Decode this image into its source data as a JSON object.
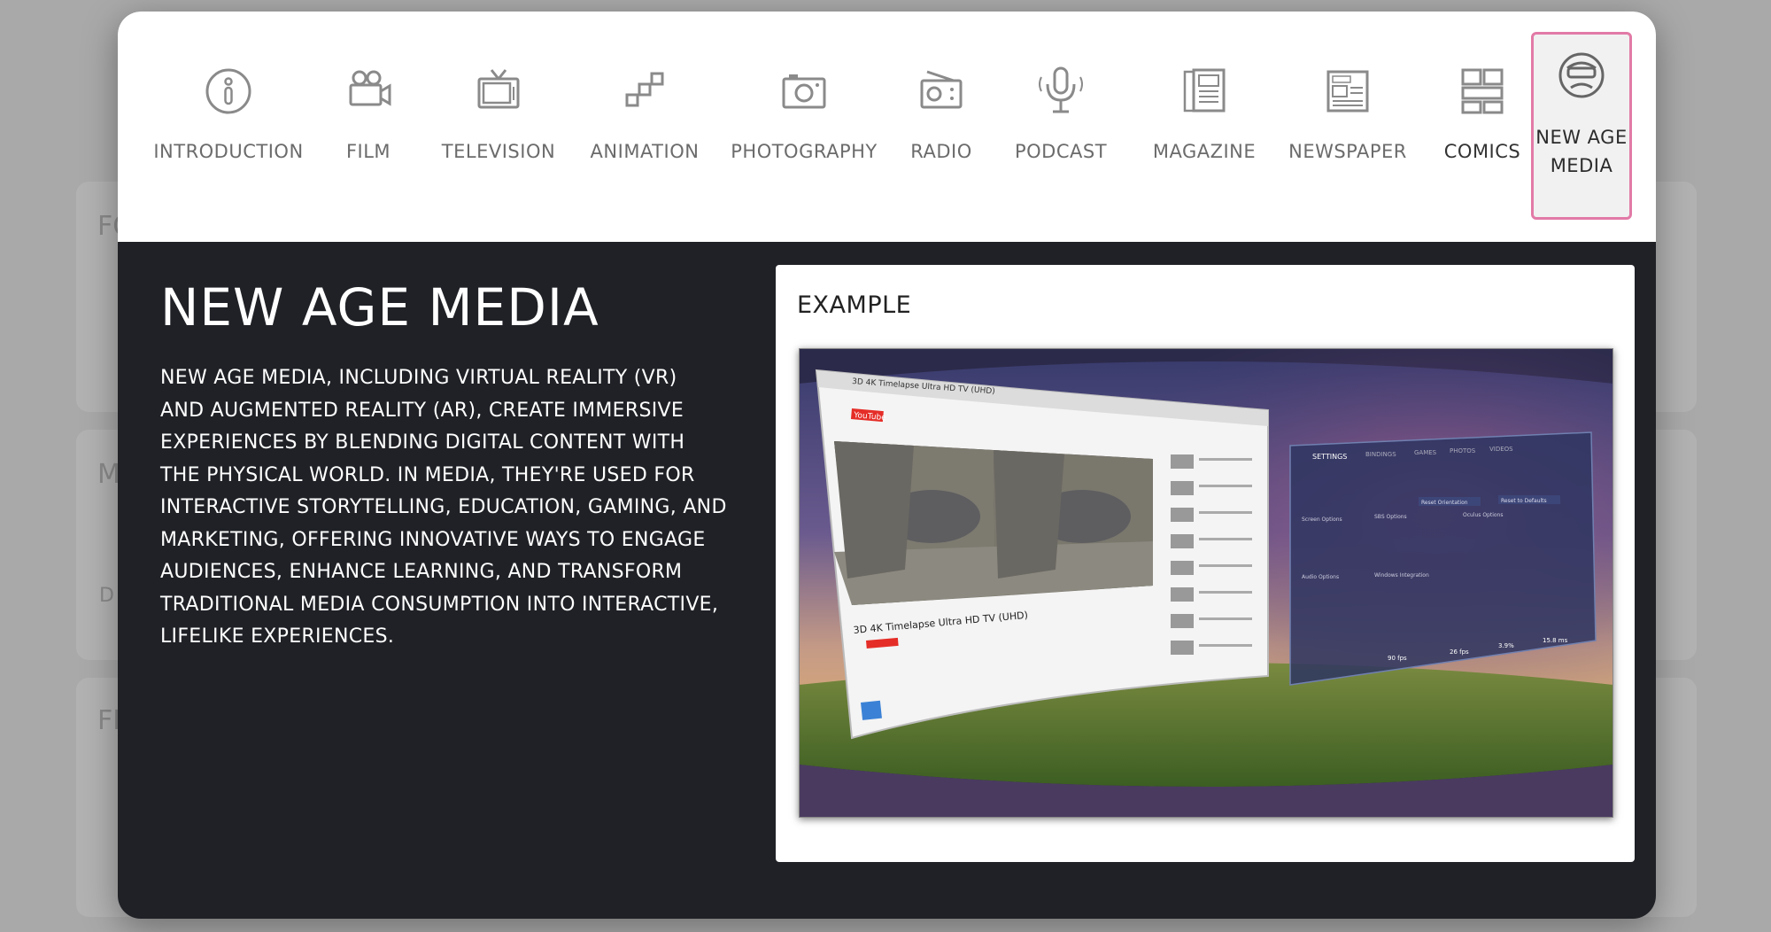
{
  "background": {
    "letters": [
      "FO",
      "M",
      "D",
      "FI"
    ]
  },
  "tabs": [
    {
      "label": "INTRODUCTION",
      "icon": "info-icon"
    },
    {
      "label": "FILM",
      "icon": "film-camera-icon"
    },
    {
      "label": "TELEVISION",
      "icon": "television-icon"
    },
    {
      "label": "ANIMATION",
      "icon": "animation-icon"
    },
    {
      "label": "PHOTOGRAPHY",
      "icon": "photo-camera-icon"
    },
    {
      "label": "RADIO",
      "icon": "radio-icon"
    },
    {
      "label": "PODCAST",
      "icon": "microphone-icon"
    },
    {
      "label": "MAGAZINE",
      "icon": "magazine-icon"
    },
    {
      "label": "NEWSPAPER",
      "icon": "newspaper-icon"
    },
    {
      "label": "COMICS",
      "icon": "comics-icon"
    },
    {
      "label": "NEW AGE MEDIA",
      "icon": "vr-headset-icon",
      "active": true
    }
  ],
  "colors": {
    "active_border": "#e27aa6",
    "panel_bg": "#1f2126"
  },
  "content": {
    "title": "NEW AGE MEDIA",
    "description": "NEW AGE MEDIA, INCLUDING VIRTUAL REALITY (VR) AND AUGMENTED REALITY (AR), CREATE IMMERSIVE EXPERIENCES BY BLENDING DIGITAL CONTENT WITH THE PHYSICAL WORLD. IN MEDIA, THEY'RE USED FOR INTERACTIVE STORYTELLING, EDUCATION, GAMING, AND MARKETING, OFFERING INNOVATIVE WAYS TO ENGAGE AUDIENCES, ENHANCE LEARNING, AND TRANSFORM TRADITIONAL MEDIA CONSUMPTION INTO INTERACTIVE, LIFELIKE EXPERIENCES.",
    "example_label": "EXAMPLE"
  },
  "example_screen": {
    "browser_title": "3D 4K Timelapse Ultra HD TV (UHD)",
    "site": "YouTube",
    "settings_tabs": [
      "SETTINGS",
      "BINDINGS",
      "GAMES",
      "PHOTOS",
      "VIDEOS"
    ],
    "settings_buttons": [
      "Reset Orientation",
      "Reset to Defaults"
    ],
    "settings_sections": [
      "Screen Options",
      "SBS Options",
      "Oculus Options",
      "Audio Options",
      "Windows Integration"
    ],
    "stats": [
      "90 fps",
      "26 fps",
      "3.9%",
      "15.8 ms"
    ]
  }
}
